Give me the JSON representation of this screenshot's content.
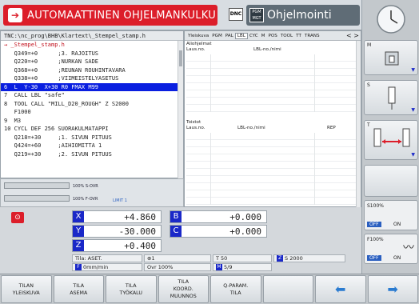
{
  "header": {
    "mode_left": "AUTOMAATTINEN OHJELMANKULKU",
    "mode_left_icon": "program-run-icon",
    "dnc": "DNC",
    "mode_right_icon_text": "PGM MGT",
    "mode_right": "Ohjelmointi"
  },
  "program": {
    "path": "TNC:\\nc_prog\\BHB\\Klartext\\_Stempel_stamp.h",
    "lines": [
      {
        "text": "→ _Stempel_stamp.h",
        "cls": "first"
      },
      {
        "text": "   Q349=+0      ;3. RAJOITUS"
      },
      {
        "text": "   Q220=+0      ;NURKAN SADE"
      },
      {
        "text": "   Q368=+0      ;REUNAN ROUHINTAVARA"
      },
      {
        "text": "   Q338=+0      ;VIIMEISTELYASETUS"
      },
      {
        "text": "6  L  Y-30  X+30 R0 FMAX M99",
        "cls": "hl"
      },
      {
        "text": "7  CALL LBL \"safe\""
      },
      {
        "text": "8  TOOL CALL \"MILL_D20_ROUGH\" Z S2000"
      },
      {
        "text": "   F1000"
      },
      {
        "text": "9  M3"
      },
      {
        "text": "10 CYCL DEF 256 SUORAKULMATAPPI"
      },
      {
        "text": "   Q218=+30     ;1. SIVUN PITUUS"
      },
      {
        "text": "   Q424=+60     ;AIHIOMITTA 1"
      },
      {
        "text": "   Q219=+30     ;2. SIVUN PITUUS"
      }
    ]
  },
  "overrides": {
    "s_ovr": "100% S-OVR",
    "f_ovr": "100% F-OVR",
    "limit": "LIMIT 1"
  },
  "tabs": {
    "items": [
      "Yleiskuva",
      "PGM",
      "PAL",
      "LBL",
      "CYC",
      "M",
      "POS",
      "TOOL",
      "TT",
      "TRANS"
    ],
    "active": "LBL",
    "nav": "< >",
    "sub_title": "Aliohjelmat",
    "sub_col1": "Laus.no.",
    "sub_col2": "LBL-no./nimi",
    "rep_title": "Toistot",
    "rep_col1": "Laus.no.",
    "rep_col2": "LBL-no./nimi",
    "rep_col3": "REP"
  },
  "axes": {
    "x_label": "X",
    "x_value": "+4.860",
    "b_label": "B",
    "b_value": "+0.000",
    "y_label": "Y",
    "y_value": "-30.000",
    "c_label": "C",
    "c_value": "+0.000",
    "z_label": "Z",
    "z_value": "+0.400"
  },
  "info": {
    "tila": "Tila: ASET.",
    "t_icon": "⊕1",
    "t_num": "T 50",
    "s_box": "Z",
    "s_val": "S 2000",
    "f_box": "F",
    "f_val": "0mm/min",
    "ovr": "Ovr 100%",
    "m_box": "M",
    "m_val": "5/9"
  },
  "sidebar": {
    "m_label": "M",
    "s_label": "S",
    "t_label": "T",
    "s100": "S100%",
    "f100": "F100%",
    "off": "OFF",
    "on": "ON"
  },
  "softkeys": [
    "TILAN\nYLEISKUVA",
    "TILA\nASEMA",
    "TILA\nTYÖKALU",
    "TILA\nKOORD.\nMUUNNOS",
    "Q-PARAM.\nTILA",
    "",
    "",
    ""
  ],
  "colors": {
    "accent_red": "#dc1e2a",
    "highlight_blue": "#0a1fe0",
    "axis_blue": "#1a28c8"
  }
}
